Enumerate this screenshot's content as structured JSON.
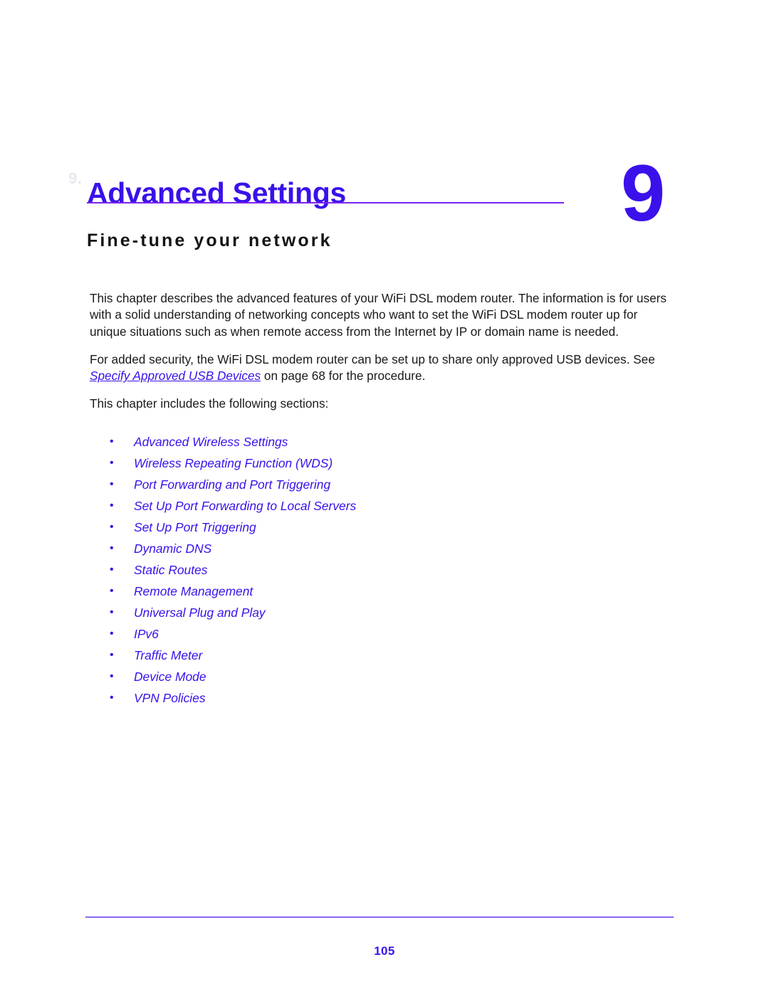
{
  "header": {
    "ghost_marker": "9.",
    "chapter_title": "Advanced Settings",
    "chapter_subtitle": "Fine-tune your network",
    "chapter_number": "9"
  },
  "body": {
    "paragraph_1": "This chapter describes the advanced features of your WiFi DSL modem router. The information is for users with a solid understanding of networking concepts who want to set the WiFi DSL modem router up for unique situations such as when remote access from the Internet by IP or domain name is needed.",
    "paragraph_2_before_link": "For added security, the WiFi DSL modem router can be set up to share only approved USB devices. See ",
    "paragraph_2_link": "Specify Approved USB Devices",
    "paragraph_2_after_link": " on page 68 for the procedure.",
    "paragraph_3": "This chapter includes the following sections:"
  },
  "section_list": {
    "bullet_glyph": "•",
    "items": [
      {
        "label": "Advanced Wireless Settings"
      },
      {
        "label": "Wireless Repeating Function (WDS)"
      },
      {
        "label": "Port Forwarding and Port Triggering"
      },
      {
        "label": "Set Up Port Forwarding to Local Servers"
      },
      {
        "label": "Set Up Port Triggering"
      },
      {
        "label": "Dynamic DNS"
      },
      {
        "label": "Static Routes"
      },
      {
        "label": "Remote Management"
      },
      {
        "label": "Universal Plug and Play"
      },
      {
        "label": "IPv6"
      },
      {
        "label": "Traffic Meter"
      },
      {
        "label": "Device Mode"
      },
      {
        "label": "VPN Policies"
      }
    ]
  },
  "footer": {
    "page_number": "105"
  },
  "colors": {
    "link_violet": "#3a11ea",
    "rule_violet": "#7a22f0",
    "footer_rule_violet": "#8b68ee",
    "body_text": "#1a1a1a"
  }
}
